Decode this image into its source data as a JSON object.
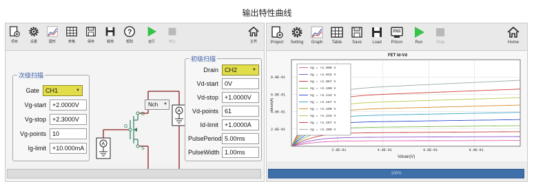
{
  "page_title": "输出特性曲线",
  "left_toolbar": [
    {
      "label": "项目",
      "icon": "project-icon"
    },
    {
      "label": "设置",
      "icon": "gear-icon"
    },
    {
      "label": "图形",
      "icon": "graph-icon"
    },
    {
      "label": "表格",
      "icon": "table-icon"
    },
    {
      "label": "保存",
      "icon": "save-icon"
    },
    {
      "label": "载荷",
      "icon": "load-icon"
    },
    {
      "label": "帮助",
      "icon": "help-icon"
    },
    {
      "label": "运行",
      "icon": "run-icon"
    },
    {
      "label": "停止",
      "icon": "stop-icon"
    },
    {
      "label": "主界",
      "icon": "home-icon"
    }
  ],
  "right_toolbar": [
    {
      "label": "Project",
      "icon": "project-icon"
    },
    {
      "label": "Setting",
      "icon": "gear-icon"
    },
    {
      "label": "Graph",
      "icon": "graph-icon"
    },
    {
      "label": "Table",
      "icon": "table-icon"
    },
    {
      "label": "Save",
      "icon": "save-icon"
    },
    {
      "label": "Load",
      "icon": "load-icon"
    },
    {
      "label": "Prtscn",
      "icon": "print-screen-icon"
    },
    {
      "label": "Run",
      "icon": "run-icon"
    },
    {
      "label": "Stop",
      "icon": "stop-icon"
    },
    {
      "label": "Home",
      "icon": "home-icon"
    }
  ],
  "secondary_sweep": {
    "title": "次级扫描",
    "gate_label": "Gate",
    "gate_value": "CH1",
    "vg_start_label": "Vg-start",
    "vg_start_value": "+2.0000V",
    "vg_stop_label": "Vg-stop",
    "vg_stop_value": "+2.3000V",
    "vg_points_label": "Vg-points",
    "vg_points_value": "10",
    "ig_limit_label": "Ig-limit",
    "ig_limit_value": "+10.000mA"
  },
  "primary_sweep": {
    "title": "初级扫描",
    "drain_label": "Drain",
    "drain_value": "CH2",
    "vd_start_label": "Vd-start",
    "vd_start_value": "0V",
    "vd_stop_label": "Vd-stop",
    "vd_stop_value": "+1.0000V",
    "vd_points_label": "Vd-points",
    "vd_points_value": "61",
    "id_limit_label": "Id-limit",
    "id_limit_value": "+1.0000A",
    "pulse_period_label": "PulsePeriod",
    "pulse_period_value": "5.00ms",
    "pulse_width_label": "PulseWidth",
    "pulse_width_value": "1.00ms"
  },
  "circuit": {
    "channel_type": "Nch",
    "terminal_drain": "D",
    "terminal_gate": "G",
    "terminal_source": "S",
    "meter_symbol": "A"
  },
  "progress_text": "100%",
  "chart_data": {
    "type": "line",
    "title": "FET Id-Vd",
    "xlabel": "Vdrain(V)",
    "ylabel": "Idrain(A)",
    "xlim": [
      0,
      1.0
    ],
    "ylim": [
      0,
      1.0
    ],
    "xticks": [
      "2.0E-01",
      "4.0E-01",
      "6.0E-01",
      "8.0E-01"
    ],
    "xtick_values": [
      0.2,
      0.4,
      0.6,
      0.8
    ],
    "yticks": [
      "2.0E-01",
      "4.0E-01",
      "6.0E-01",
      "8.0E-01"
    ],
    "ytick_values": [
      0.2,
      0.4,
      0.6,
      0.8
    ],
    "legend_position": "top-left",
    "series": [
      {
        "name": "Vg = +2.000 V",
        "color": "#e05aa8",
        "sat": 0.06,
        "k": 0.1
      },
      {
        "name": "Vg = +2.033 V",
        "color": "#8a4fc7",
        "sat": 0.1,
        "k": 0.11
      },
      {
        "name": "Vg = +2.067 V",
        "color": "#c23a3a",
        "sat": 0.15,
        "k": 0.12
      },
      {
        "name": "Vg = +2.100 V",
        "color": "#79b94a",
        "sat": 0.21,
        "k": 0.13
      },
      {
        "name": "Vg = +2.133 V",
        "color": "#2b4fcf",
        "sat": 0.27,
        "k": 0.14
      },
      {
        "name": "Vg = +2.167 V",
        "color": "#3aa0c8",
        "sat": 0.34,
        "k": 0.15
      },
      {
        "name": "Vg = +2.200 V",
        "color": "#d98a2a",
        "sat": 0.41,
        "k": 0.16
      },
      {
        "name": "Vg = +2.233 V",
        "color": "#b8c84a",
        "sat": 0.48,
        "k": 0.17
      },
      {
        "name": "Vg = +2.267 V",
        "color": "#d43a3a",
        "sat": 0.56,
        "k": 0.18
      },
      {
        "name": "Vg = +2.300 V",
        "color": "#9aa8a8",
        "sat": 0.64,
        "k": 0.19
      }
    ]
  }
}
